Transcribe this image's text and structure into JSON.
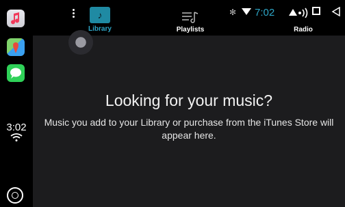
{
  "dock": {
    "time": "3:02"
  },
  "tabs": {
    "library": "Library",
    "playlists": "Playlists",
    "radio": "Radio"
  },
  "status": {
    "time": "7:02"
  },
  "empty_state": {
    "heading": "Looking for your music?",
    "message": "Music you add to your Library or purchase from the iTunes Store will appear here."
  },
  "colors": {
    "accent": "#2ea7c8",
    "background": "#1c1c1e"
  }
}
